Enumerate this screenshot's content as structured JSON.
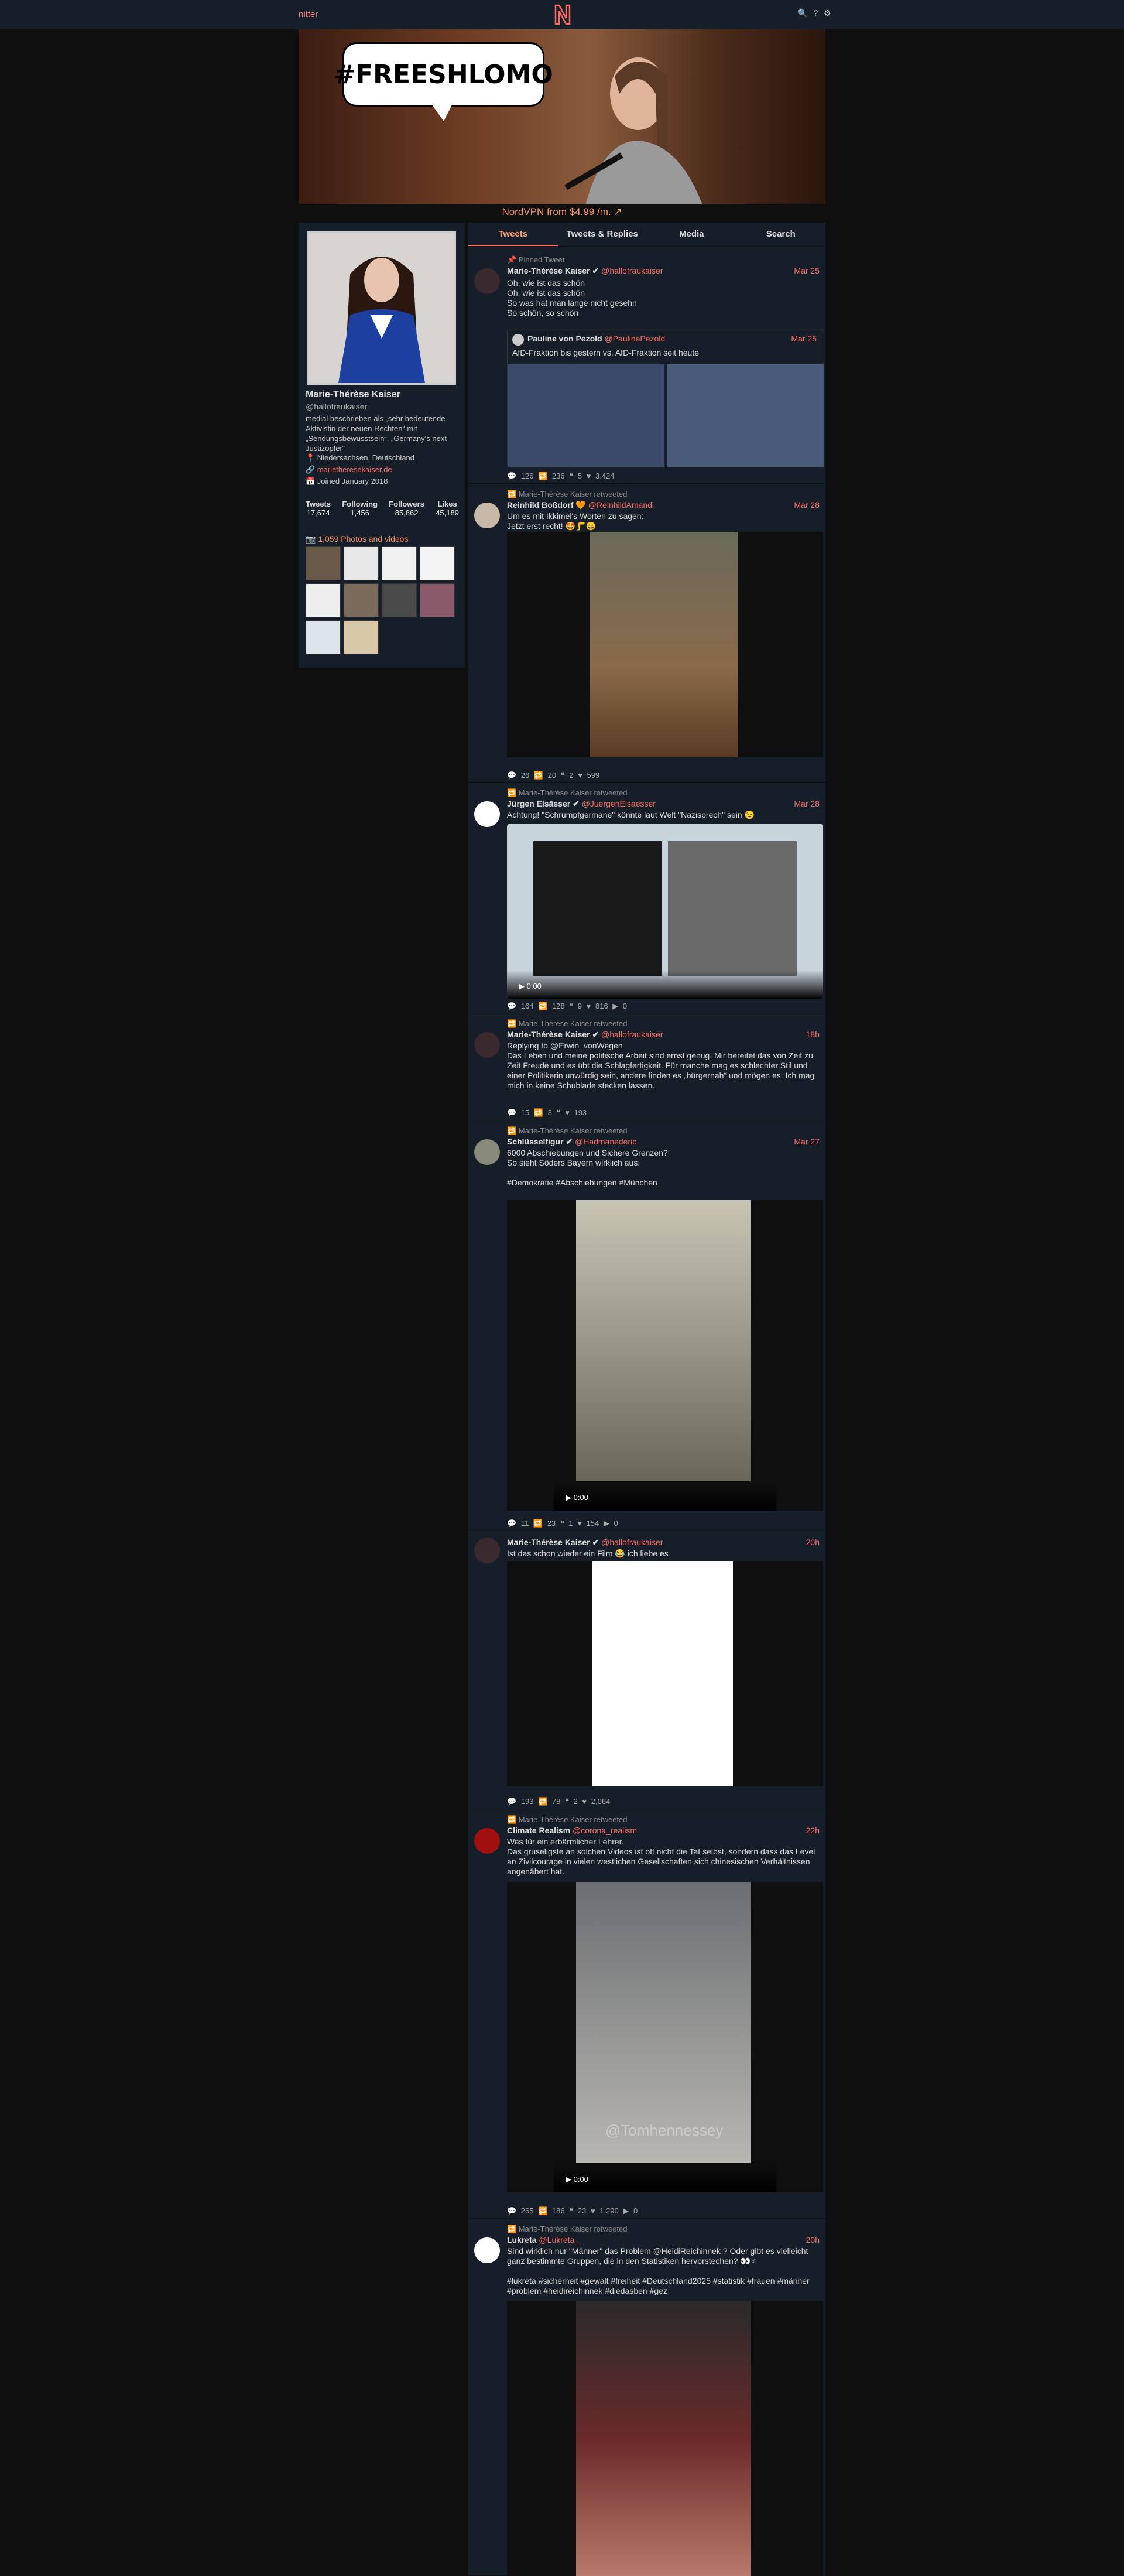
{
  "nav": {
    "brand": "nitter",
    "icons": "🔍 ? ⚙"
  },
  "banner": {
    "bubble_text": "#FREESHLOMO"
  },
  "promo": "NordVPN from $4.99 /m. ↗",
  "profile": {
    "name": "Marie-Thérèse Kaiser",
    "handle": "@hallofraukaiser",
    "bio": "medial beschrieben als „sehr bedeutende Aktivistin der neuen Rechten“ mit „Sendungsbewusstsein“, „Germany's next Justizopfer“",
    "location": "📍 Niedersachsen, Deutschland",
    "website": "🔗 marietheresekaiser.de",
    "joined": "📅 Joined January 2018",
    "stats": [
      {
        "label": "Tweets",
        "value": "17,674"
      },
      {
        "label": "Following",
        "value": "1,456"
      },
      {
        "label": "Followers",
        "value": "85,862"
      },
      {
        "label": "Likes",
        "value": "45,189"
      }
    ],
    "media_title": "📷 1,059 Photos and videos"
  },
  "tabs": [
    "Tweets",
    "Tweets & Replies",
    "Media",
    "Search"
  ],
  "tweets": [
    {
      "retweet": "📌 Pinned Tweet",
      "name": "Marie-Thérèse Kaiser ✔",
      "handle": "@hallofraukaiser",
      "date": "Mar 25",
      "body": "Oh, wie ist das schön\nOh, wie ist das schön\nSo was hat man lange nicht gesehn\nSo schön, so schön",
      "quote": {
        "name": "Pauline von Pezold",
        "handle": "@PaulinePezold",
        "date": "Mar 25",
        "body": "AfD-Fraktion bis gestern vs. AfD-Fraktion seit heute"
      },
      "stats": "💬 126   🔁 236   ❝ 5   ♥ 3,424"
    },
    {
      "retweet": "🔁 Marie-Thérèse Kaiser retweeted",
      "name": "Reinhild Boßdorf 🧡",
      "handle": "@ReinhildAmandi",
      "date": "Mar 28",
      "body": "Um es mit Ikkimel's Worten zu sagen:\nJetzt erst recht! 🤩🦵😄",
      "stats": "💬 26   🔁 20   ❝ 2   ♥ 599"
    },
    {
      "retweet": "🔁 Marie-Thérèse Kaiser retweeted",
      "name": "Jürgen Elsässer ✔",
      "handle": "@JuergenElsaesser",
      "date": "Mar 28",
      "body": "Achtung! \"Schrumpfgermane\" könnte laut Welt \"Nazisprech\" sein 😉",
      "video_time": "0:00",
      "stats": "💬 164   🔁 128   ❝ 9   ♥ 816   ▶ 0"
    },
    {
      "retweet": "🔁 Marie-Thérèse Kaiser retweeted",
      "name": "Marie-Thérèse Kaiser ✔",
      "handle": "@hallofraukaiser",
      "date": "18h",
      "body": "Replying to @Erwin_vonWegen\nDas Leben und meine politische Arbeit sind ernst genug. Mir bereitet das von Zeit zu Zeit Freude und es übt die Schlagfertigkeit. Für manche mag es schlechter Stil und einer Politikerin unwürdig sein, andere finden es „bürgernah“ und mögen es. Ich mag mich in keine Schublade stecken lassen.",
      "stats": "💬 15   🔁 3   ❝   ♥ 193"
    },
    {
      "retweet": "🔁 Marie-Thérèse Kaiser retweeted",
      "name": "Schlüsselfigur ✔",
      "handle": "@Hadmanederic",
      "date": "Mar 27",
      "body": "6000 Abschiebungen und Sichere Grenzen?\nSo sieht Söders Bayern wirklich aus:\n\n#Demokratie #Abschiebungen #München",
      "video_time": "0:00",
      "stats": "💬 11   🔁 23   ❝ 1   ♥ 154   ▶ 0"
    },
    {
      "retweet": "",
      "name": "Marie-Thérèse Kaiser ✔",
      "handle": "@hallofraukaiser",
      "date": "20h",
      "body": "Ist das schon wieder ein Film 😂 ich liebe es",
      "stats": "💬 193   🔁 78   ❝ 2   ♥ 2,064"
    },
    {
      "retweet": "🔁 Marie-Thérèse Kaiser retweeted",
      "name": "Climate Realism",
      "handle": "@corona_realism",
      "date": "22h",
      "body": "Was für ein erbärmlicher Lehrer.\nDas gruseligste an solchen Videos ist oft nicht die Tat selbst, sondern dass das Level an Zivilcourage in vielen westlichen Gesellschaften sich chinesischen Verhältnissen angenähert hat.",
      "video_time": "0:00",
      "watermark": "@Tomhennessey",
      "stats": "💬 265   🔁 186   ❝ 23   ♥ 1,290   ▶ 0"
    },
    {
      "retweet": "🔁 Marie-Thérèse Kaiser retweeted",
      "name": "Lukreta",
      "handle": "@Lukreta_",
      "date": "20h",
      "body": "Sind wirklich nur \"Männer\" das Problem @HeidiReichinnek ? Oder gibt es vielleicht ganz bestimmte Gruppen, die in den Statistiken hervorstechen? 👀♂\n\n#lukreta #sicherheit #gewalt #freiheit #Deutschland2025 #statistik #frauen #männer #problem #heidireichinnek #diedasben #gez",
      "stats": ""
    }
  ]
}
